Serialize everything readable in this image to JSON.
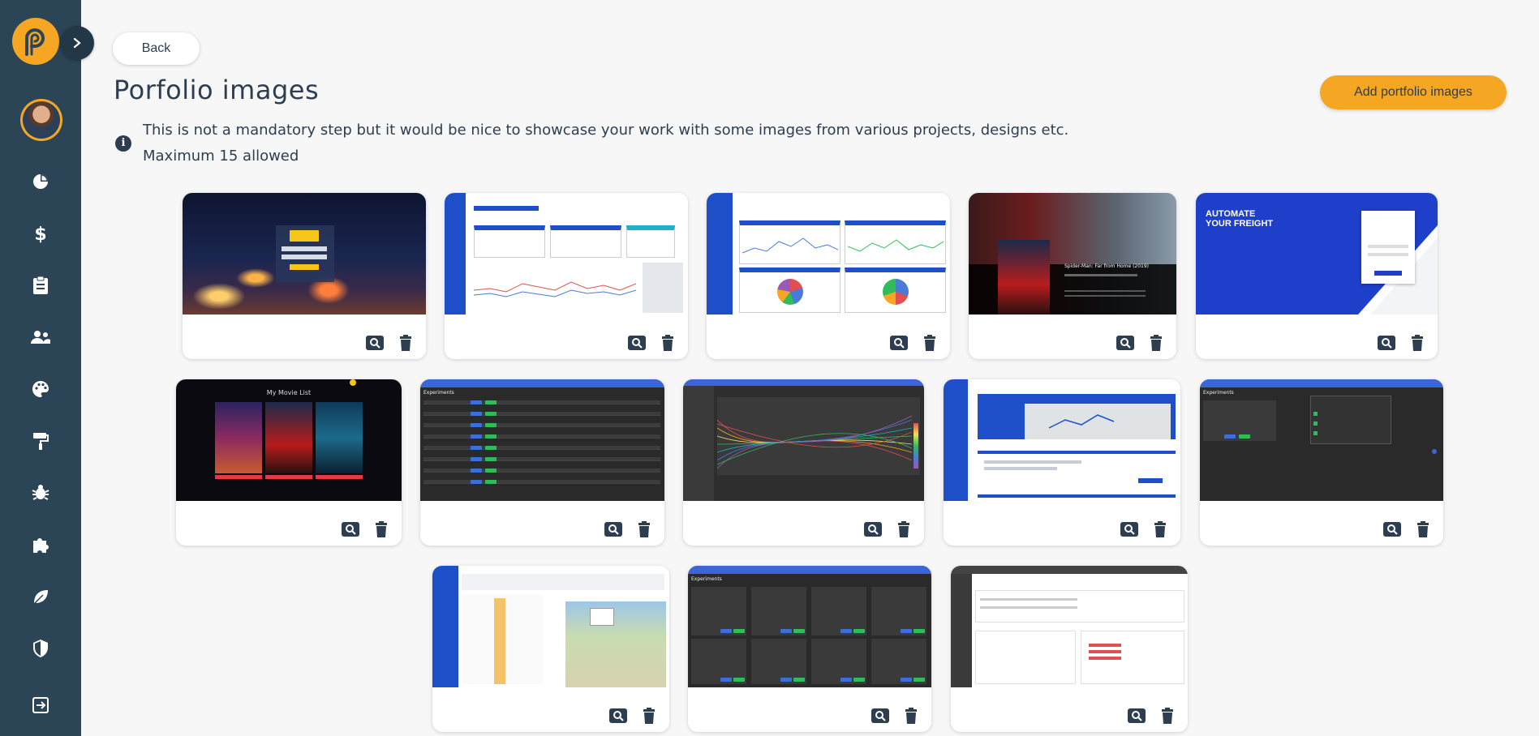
{
  "nav": {
    "back_label": "Back",
    "page_title": "Porfolio images",
    "add_label": "Add portfolio images"
  },
  "info": {
    "line1": "This is not a mandatory step but it would be nice to showcase your work with some images from various projects, designs etc.",
    "line2": "Maximum 15 allowed"
  },
  "sidebar": {
    "items": [
      "pie-chart-icon",
      "dollar-icon",
      "clipboard-icon",
      "users-icon",
      "palette-icon",
      "paint-roller-icon",
      "bug-icon",
      "puzzle-icon",
      "leaf-icon",
      "shield-icon",
      "logout-icon"
    ]
  },
  "colors": {
    "sidebar": "#2b4556",
    "accent": "#f5a623",
    "text": "#2c3e50"
  },
  "thumbs": {
    "t4_caption": "Spider-Man: Far from Home (2019)",
    "t5_line1": "AUTOMATE",
    "t5_line2": "YOUR FREIGHT",
    "t6_caption": "My Movie List",
    "t7_caption": "Experiments",
    "t10_caption": "Experiments",
    "t12_caption": "Experiments"
  },
  "portfolio_count": 13
}
